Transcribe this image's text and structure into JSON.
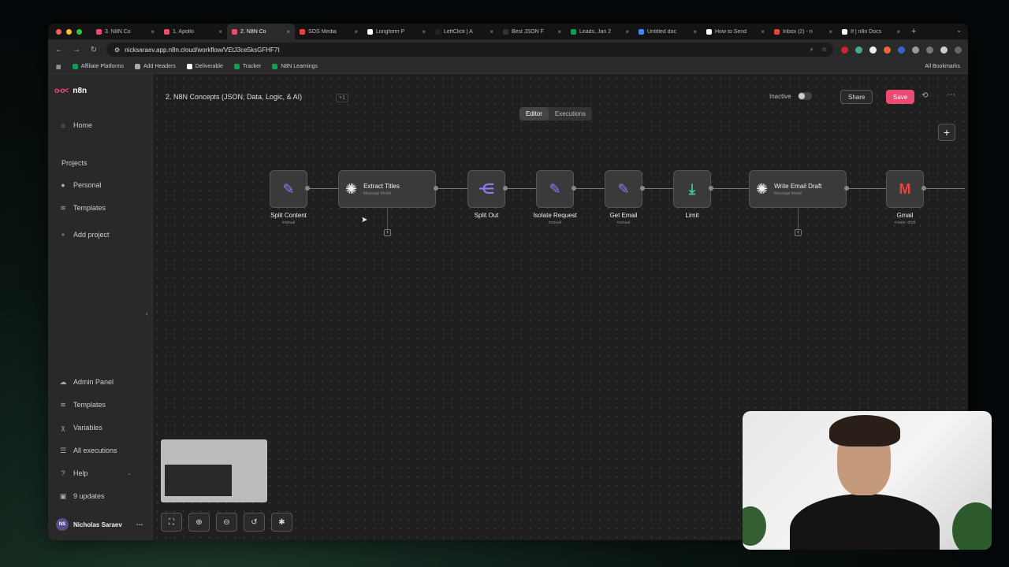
{
  "browser": {
    "tabs": [
      {
        "label": "3. N8N Co",
        "color": "#ea4b71",
        "active": false
      },
      {
        "label": "1. Apollo",
        "color": "#ea4b71",
        "active": false
      },
      {
        "label": "2. N8N Co",
        "color": "#ea4b71",
        "active": true
      },
      {
        "label": "SOS Media",
        "color": "#ea4335",
        "active": false
      },
      {
        "label": "Longform P",
        "color": "#ffffff",
        "active": false
      },
      {
        "label": "LeftClick | A",
        "color": "#222222",
        "active": false
      },
      {
        "label": "Best JSON F",
        "color": "#333333",
        "active": false
      },
      {
        "label": "Leads, Jan 2",
        "color": "#0f9d58",
        "active": false
      },
      {
        "label": "Untitled doc",
        "color": "#4285f4",
        "active": false
      },
      {
        "label": "How to Send",
        "color": "#ffffff",
        "active": false
      },
      {
        "label": "Inbox (2) - n",
        "color": "#ea4335",
        "active": false
      },
      {
        "label": "If | n8n Docs",
        "color": "#ffffff",
        "active": false
      }
    ],
    "url": "nicksaraev.app.n8n.cloud/workflow/VEtJ3ce5ksGFHF7t",
    "bookmarks": [
      {
        "label": "Affiliate Platforms",
        "color": "#0f9d58"
      },
      {
        "label": "Add Headers",
        "color": "#aaaaaa"
      },
      {
        "label": "Deliverable",
        "color": "#ffffff"
      },
      {
        "label": "Tracker",
        "color": "#0f9d58"
      },
      {
        "label": "N8N Learnings",
        "color": "#0f9d58"
      }
    ],
    "all_bookmarks": "All Bookmarks"
  },
  "sidebar": {
    "brand": "n8n",
    "home": "Home",
    "projects_title": "Projects",
    "personal": "Personal",
    "templates": "Templates",
    "add_project": "Add project",
    "admin_panel": "Admin Panel",
    "templates_bottom": "Templates",
    "variables": "Variables",
    "all_executions": "All executions",
    "help": "Help",
    "updates": "9 updates",
    "user_name": "Nicholas Saraev",
    "user_initials": "NS"
  },
  "topbar": {
    "workflow_title": "2. N8N Concepts (JSON, Data, Logic, & AI)",
    "tag": "+1",
    "tab_editor": "Editor",
    "tab_executions": "Executions",
    "status": "Inactive",
    "share": "Share",
    "save": "Save"
  },
  "nodes": [
    {
      "label": "Split Content",
      "sub": "manual",
      "icon": "pencil-icon"
    },
    {
      "label": "Extract Titles",
      "sub": "Message Model",
      "icon": "openai-icon"
    },
    {
      "label": "Split Out",
      "sub": "",
      "icon": "split-icon"
    },
    {
      "label": "Isolate Request",
      "sub": "manual",
      "icon": "pencil-icon"
    },
    {
      "label": "Get Email",
      "sub": "manual",
      "icon": "pencil-icon"
    },
    {
      "label": "Limit",
      "sub": "",
      "icon": "limit-icon"
    },
    {
      "label": "Write Email Draft",
      "sub": "Message Model",
      "icon": "openai-icon"
    },
    {
      "label": "Gmail",
      "sub": "create: draft",
      "icon": "gmail-icon"
    }
  ]
}
